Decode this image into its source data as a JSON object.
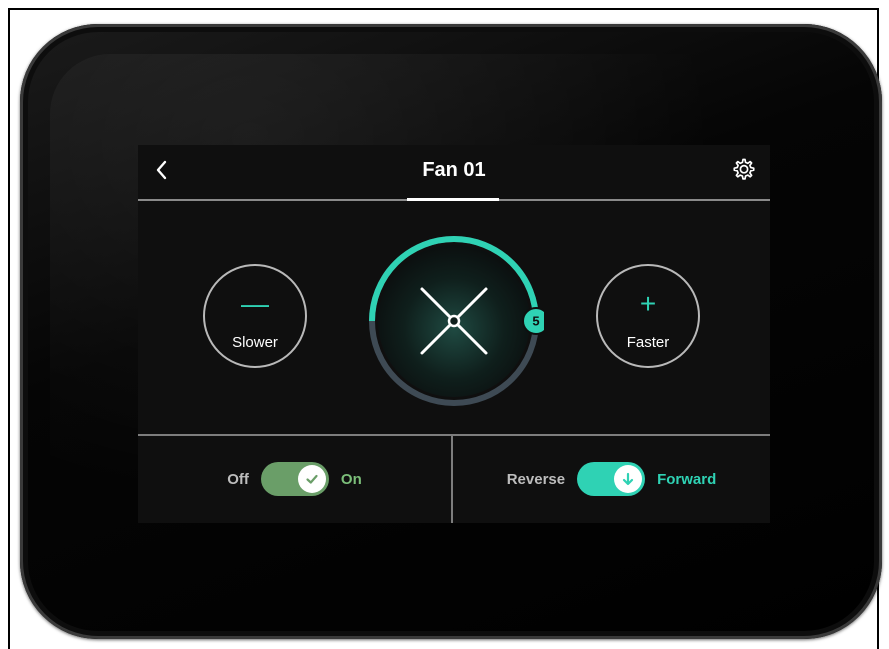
{
  "screen": {
    "title": "Fan 01",
    "back_icon": "chevron-left-icon",
    "settings_icon": "gear-icon"
  },
  "speed": {
    "slower_label": "Slower",
    "slower_symbol": "—",
    "faster_label": "Faster",
    "faster_symbol": "+",
    "level": "5",
    "level_fraction": 0.5
  },
  "power": {
    "off_label": "Off",
    "on_label": "On",
    "state": true
  },
  "direction": {
    "reverse_label": "Reverse",
    "forward_label": "Forward",
    "state": "Forward",
    "icon": "arrow-down-icon"
  },
  "colors": {
    "accent": "#2fd2b4",
    "power_toggle": "#6a9e68",
    "power_text": "#7cbf7a",
    "muted_text": "#bdbdbd",
    "dial_track": "#3e4a54"
  }
}
